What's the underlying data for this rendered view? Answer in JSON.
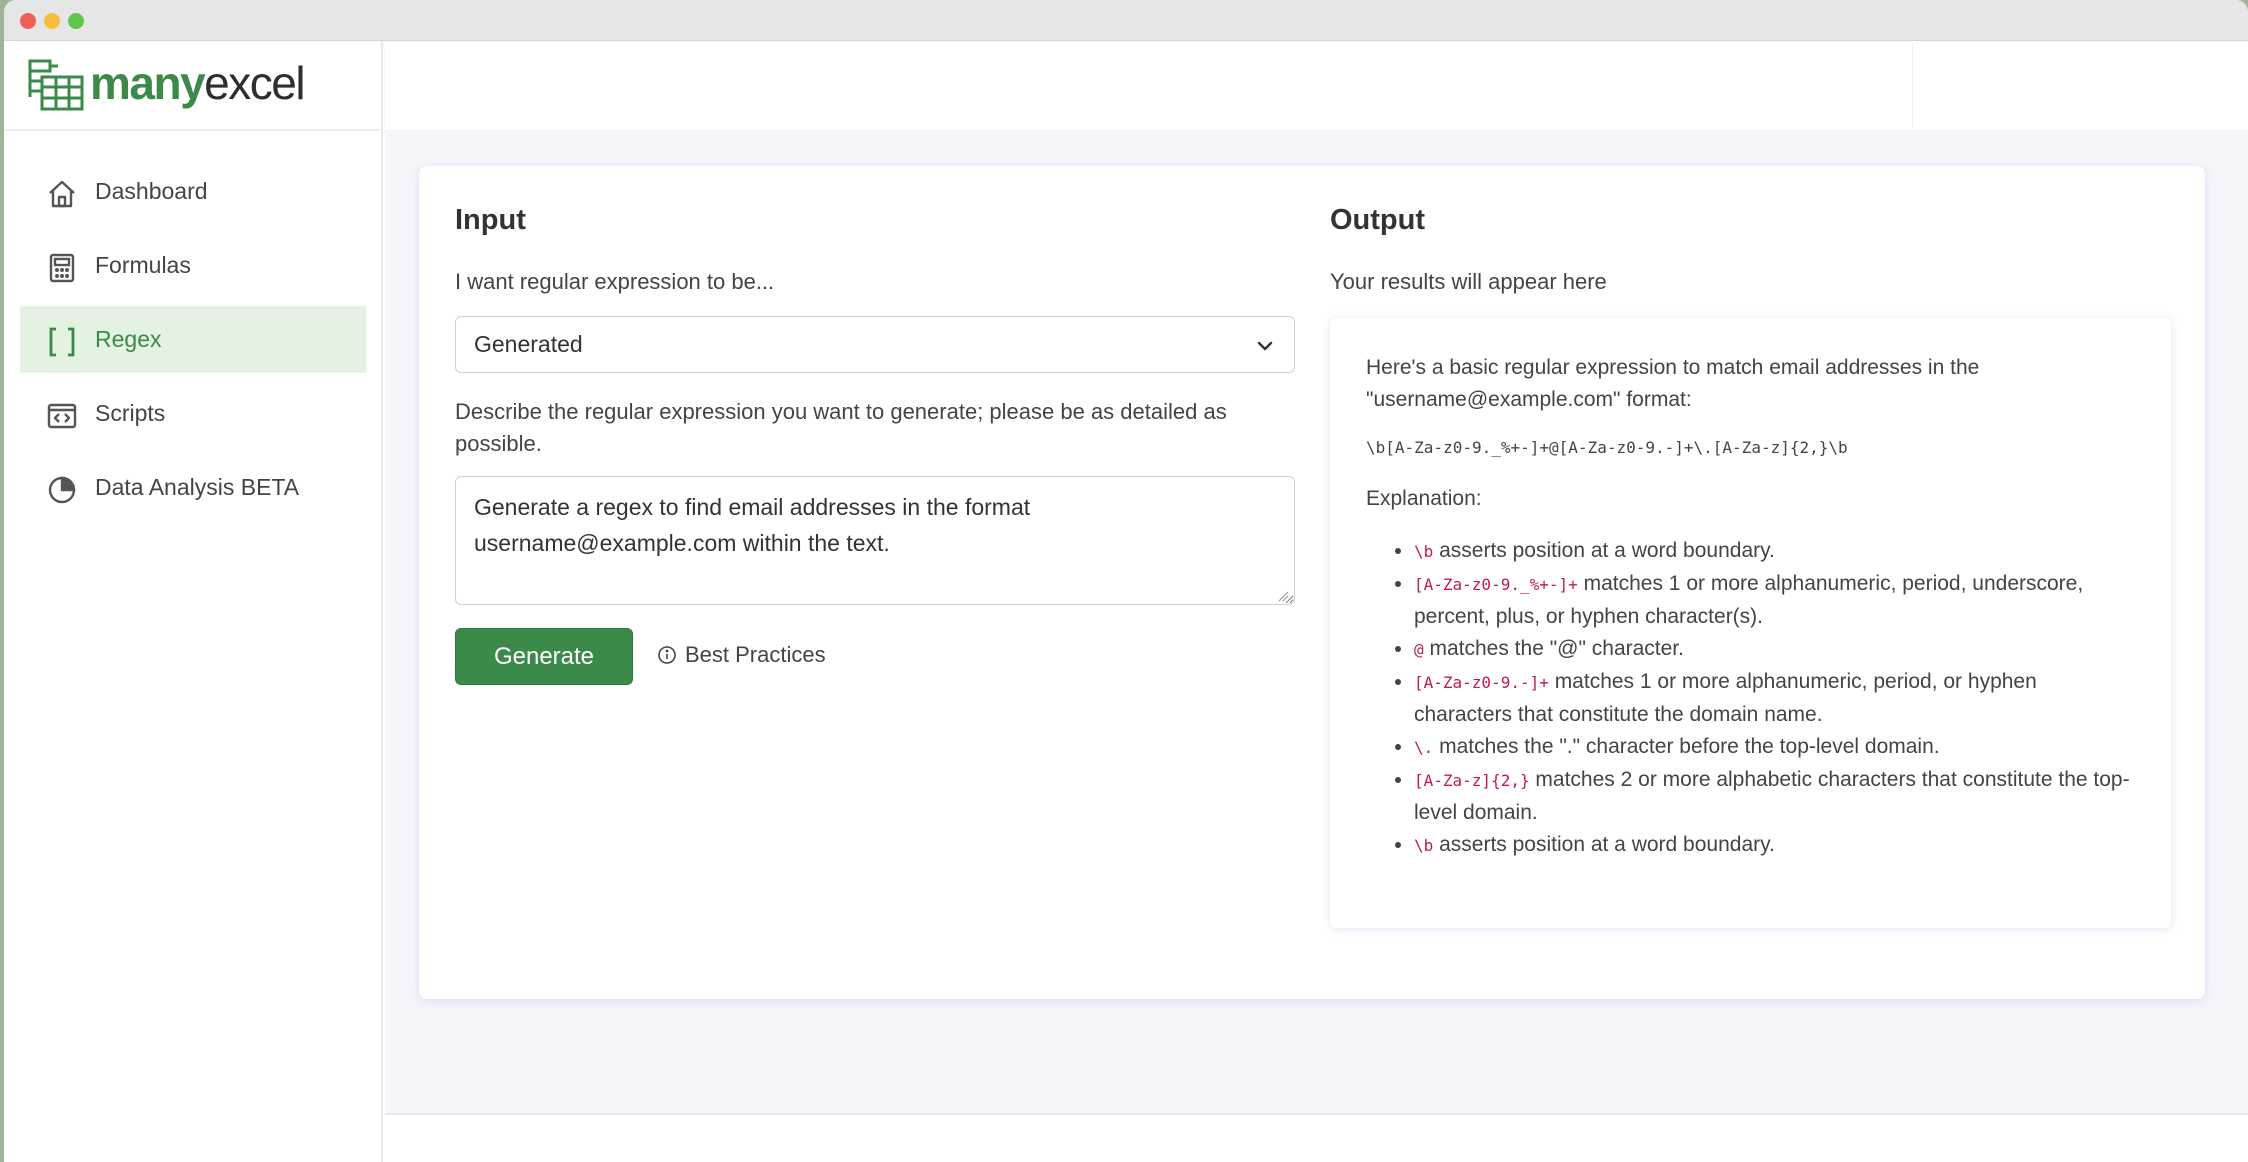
{
  "app": {
    "brand_bold": "many",
    "brand_light": "excel"
  },
  "sidebar": {
    "items": [
      {
        "label": "Dashboard",
        "icon": "home-icon",
        "active": false
      },
      {
        "label": "Formulas",
        "icon": "calculator-icon",
        "active": false
      },
      {
        "label": "Regex",
        "icon": "brackets-icon",
        "active": true
      },
      {
        "label": "Scripts",
        "icon": "code-window-icon",
        "active": false
      },
      {
        "label": "Data Analysis BETA",
        "icon": "pie-chart-icon",
        "active": false
      }
    ]
  },
  "input": {
    "title": "Input",
    "mode_label": "I want regular expression to be...",
    "mode_value": "Generated",
    "describe_label": "Describe the regular expression you want to generate; please be as detailed as possible.",
    "prompt_value": "Generate a regex to find email addresses in the format username@example.com within the text.",
    "generate_label": "Generate",
    "best_practices_label": "Best Practices"
  },
  "output": {
    "title": "Output",
    "subtitle": "Your results will appear here",
    "intro": "Here's a basic regular expression to match email addresses in the \"username@example.com\" format:",
    "regex": "\\b[A-Za-z0-9._%+-]+@[A-Za-z0-9.-]+\\.[A-Za-z]{2,}\\b",
    "explanation_label": "Explanation:",
    "items": [
      {
        "token": "\\b",
        "text": " asserts position at a word boundary."
      },
      {
        "token": "[A-Za-z0-9._%+-]+",
        "text": " matches 1 or more alphanumeric, period, underscore, percent, plus, or hyphen character(s)."
      },
      {
        "token": "@",
        "text": " matches the \"@\" character."
      },
      {
        "token": "[A-Za-z0-9.-]+",
        "text": " matches 1 or more alphanumeric, period, or hyphen characters that constitute the domain name."
      },
      {
        "token": "\\.",
        "text": " matches the \".\" character before the top-level domain."
      },
      {
        "token": "[A-Za-z]{2,}",
        "text": " matches 2 or more alphabetic characters that constitute the top-level domain."
      },
      {
        "token": "\\b",
        "text": " asserts position at a word boundary."
      }
    ]
  },
  "colors": {
    "brand_green": "#3b8a4a",
    "active_bg": "#e3f2e1",
    "code_token": "#c2185b",
    "page_bg": "#f5f5fb"
  }
}
